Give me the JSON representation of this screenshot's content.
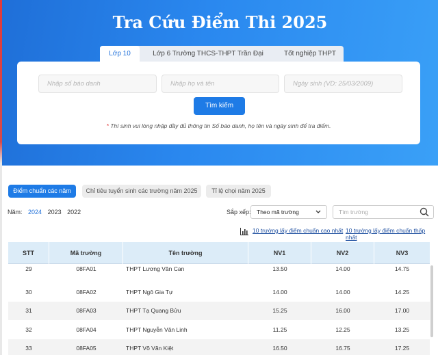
{
  "hero": {
    "title": "Tra Cứu Điểm Thi 2025"
  },
  "tabs": [
    {
      "label": "Lớp 10"
    },
    {
      "label": "Lớp 6 Trường THCS-THPT Trần Đại Nghĩa"
    },
    {
      "label": "Tốt nghiệp THPT"
    }
  ],
  "form": {
    "sbd_placeholder": "Nhập số báo danh",
    "name_placeholder": "Nhập họ và tên",
    "dob_placeholder": "Ngày sinh (VD: 25/03/2009)",
    "search_label": "Tìm kiếm",
    "note_star": "*",
    "note": "Thí sinh vui lòng nhập đầy đủ thông tin Số báo danh, họ tên và ngày sinh để tra điểm."
  },
  "filter_tabs": [
    {
      "label": "Điểm chuẩn các năm"
    },
    {
      "label": "Chỉ tiêu tuyển sinh các trường năm 2025"
    },
    {
      "label": "Tỉ lệ chọi năm 2025"
    }
  ],
  "years": {
    "label": "Năm:",
    "items": [
      "2024",
      "2023",
      "2022"
    ]
  },
  "sort": {
    "label": "Sắp xếp:",
    "value": "Theo mã trường",
    "search_placeholder": "Tìm trường"
  },
  "links": {
    "top_high": "10 trường lấy điểm chuẩn cao nhất",
    "top_low": "10 trường lấy điểm chuẩn thấp nhất"
  },
  "table": {
    "headers": [
      "STT",
      "Mã trường",
      "Tên trường",
      "NV1",
      "NV2",
      "NV3"
    ],
    "rows": [
      [
        "29",
        "08FA01",
        "THPT Lương Văn Can",
        "13.50",
        "14.00",
        "14.75"
      ],
      [
        "30",
        "08FA02",
        "THPT Ngô Gia Tự",
        "14.00",
        "14.00",
        "14.25"
      ],
      [
        "31",
        "08FA03",
        "THPT Tạ Quang Bửu",
        "15.25",
        "16.00",
        "17.00"
      ],
      [
        "32",
        "08FA04",
        "THPT Nguyễn Văn Linh",
        "11.25",
        "12.25",
        "13.25"
      ],
      [
        "33",
        "08FA05",
        "THPT Võ Văn Kiệt",
        "16.50",
        "16.75",
        "17.25"
      ]
    ]
  },
  "icons": {
    "search": "search-icon",
    "chevron": "chevron-down-icon",
    "bars": "bar-chart-icon"
  },
  "colors": {
    "primary": "#1e7be6",
    "hero_start": "#1f6fd8",
    "hero_end": "#3aa0f7",
    "header_bg": "#dcecf8"
  }
}
